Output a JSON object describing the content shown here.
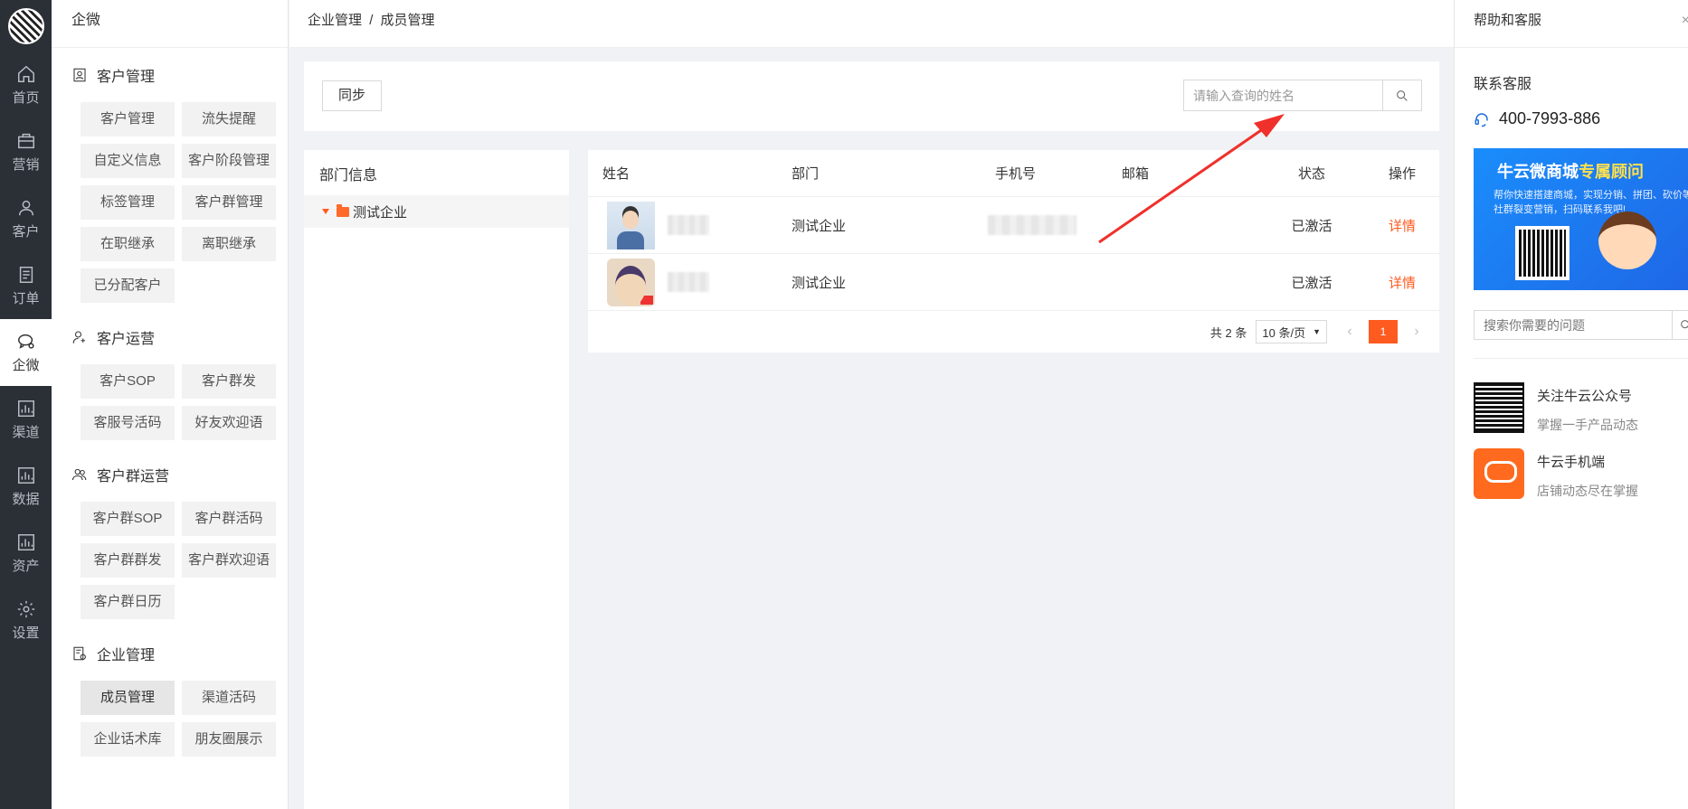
{
  "rail": {
    "items": [
      {
        "label": "首页",
        "icon": "home-icon"
      },
      {
        "label": "营销",
        "icon": "briefcase-icon"
      },
      {
        "label": "客户",
        "icon": "user-icon"
      },
      {
        "label": "订单",
        "icon": "order-icon"
      },
      {
        "label": "企微",
        "icon": "wecom-chat-icon",
        "active": true
      },
      {
        "label": "渠道",
        "icon": "chart-icon"
      },
      {
        "label": "数据",
        "icon": "chart-icon"
      },
      {
        "label": "资产",
        "icon": "chart-icon"
      },
      {
        "label": "设置",
        "icon": "gear-icon"
      }
    ]
  },
  "menu": {
    "title": "企微",
    "groups": [
      {
        "title": "客户管理",
        "items": [
          "客户管理",
          "流失提醒",
          "自定义信息",
          "客户阶段管理",
          "标签管理",
          "客户群管理",
          "在职继承",
          "离职继承",
          "已分配客户"
        ]
      },
      {
        "title": "客户运营",
        "items": [
          "客户SOP",
          "客户群发",
          "客服号活码",
          "好友欢迎语"
        ]
      },
      {
        "title": "客户群运营",
        "items": [
          "客户群SOP",
          "客户群活码",
          "客户群群发",
          "客户群欢迎语",
          "客户群日历"
        ]
      },
      {
        "title": "企业管理",
        "items": [
          "成员管理",
          "渠道活码",
          "企业话术库",
          "朋友圈展示"
        ],
        "active_item": "成员管理"
      }
    ]
  },
  "header": {
    "breadcrumb_parent": "企业管理",
    "breadcrumb_sep": "/",
    "breadcrumb_current": "成员管理"
  },
  "toolbar": {
    "sync_label": "同步",
    "search_placeholder": "请输入查询的姓名"
  },
  "dept": {
    "title": "部门信息",
    "node": "测试企业"
  },
  "table": {
    "columns": [
      "姓名",
      "部门",
      "手机号",
      "邮箱",
      "状态",
      "操作"
    ],
    "rows": [
      {
        "dept": "测试企业",
        "status": "已激活",
        "action": "详情"
      },
      {
        "dept": "测试企业",
        "status": "已激活",
        "action": "详情"
      }
    ],
    "total": "共 2 条",
    "page_size": "10 条/页",
    "page": "1"
  },
  "help": {
    "title": "帮助和客服",
    "close": "×",
    "contact_title": "联系客服",
    "hotline": "400-7993-886",
    "banner_title_a": "牛云微商城",
    "banner_title_b": "专属顾问",
    "banner_text": "帮你快速搭建商城，实现分销、拼团、砍价等社群裂变营销，扫码联系我吧!",
    "search_placeholder": "搜索你需要的问题",
    "items": [
      {
        "title": "关注牛云公众号",
        "desc": "掌握一手产品动态"
      },
      {
        "title": "牛云手机端",
        "desc": "店铺动态尽在掌握"
      }
    ]
  },
  "colors": {
    "accent": "#ff5a1f",
    "rail_bg": "#2b2f36",
    "annotation_arrow": "#f0302a"
  }
}
